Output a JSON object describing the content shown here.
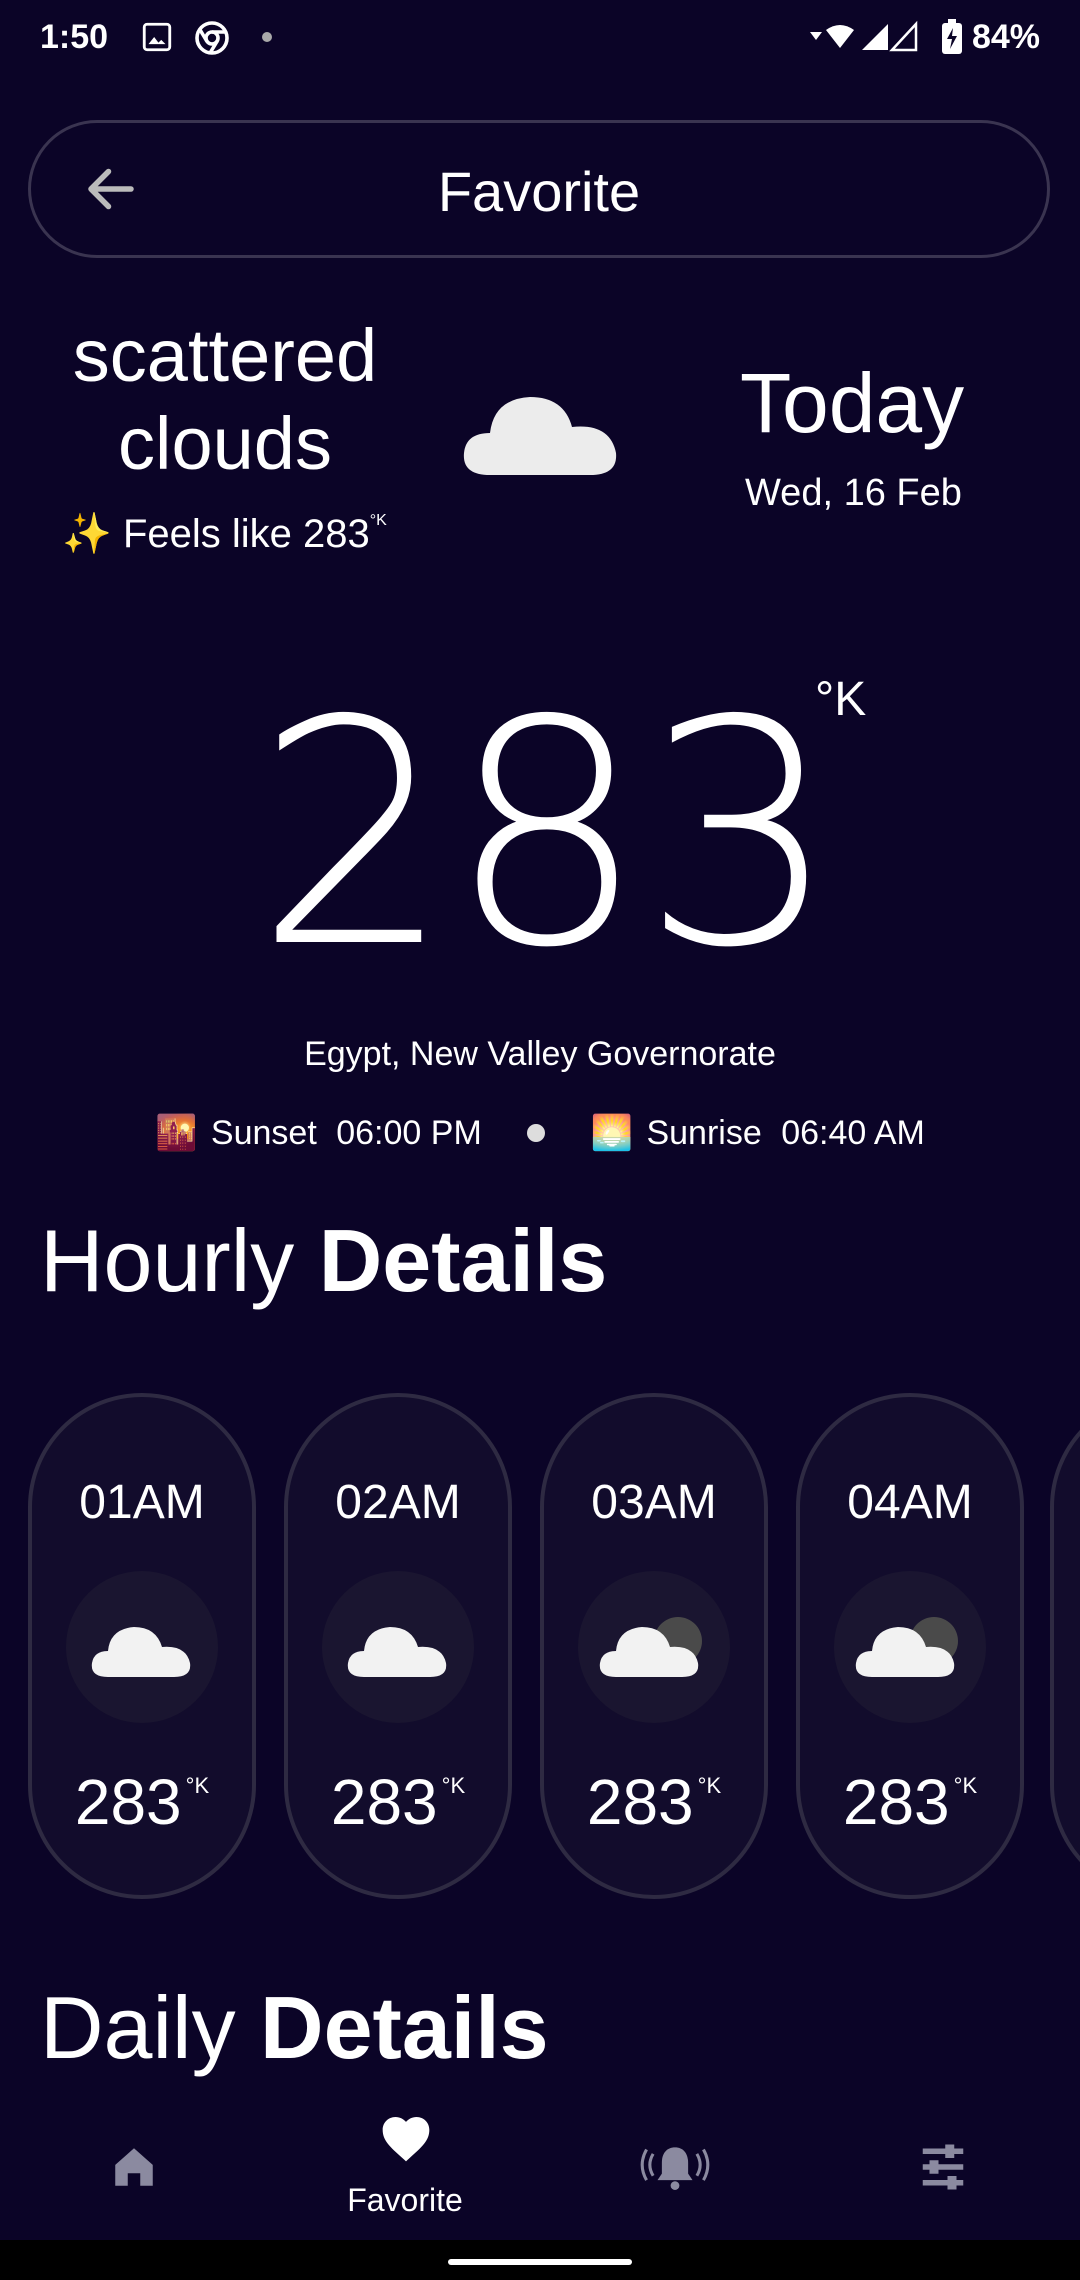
{
  "status_bar": {
    "time": "1:50",
    "battery": "84%"
  },
  "header": {
    "title": "Favorite"
  },
  "current": {
    "description_line1": "scattered",
    "description_line2": "clouds",
    "feels_like_label": "Feels like",
    "feels_like_value": "283",
    "feels_like_unit": "°K",
    "day_label": "Today",
    "date": "Wed, 16 Feb",
    "temperature": "283",
    "unit": "°K",
    "location": "Egypt, New Valley Governorate",
    "sunset_label": "Sunset",
    "sunset_time": "06:00 PM",
    "sunrise_label": "Sunrise",
    "sunrise_time": "06:40 AM"
  },
  "hourly": {
    "title_light": "Hourly",
    "title_bold": "Details",
    "items": [
      {
        "hour": "01AM",
        "temp": "283",
        "unit": "°K",
        "icon": "cloud-icon"
      },
      {
        "hour": "02AM",
        "temp": "283",
        "unit": "°K",
        "icon": "cloud-icon"
      },
      {
        "hour": "03AM",
        "temp": "283",
        "unit": "°K",
        "icon": "cloud-moon-icon"
      },
      {
        "hour": "04AM",
        "temp": "283",
        "unit": "°K",
        "icon": "cloud-moon-icon"
      }
    ]
  },
  "daily": {
    "title_light": "Daily",
    "title_bold": "Details"
  },
  "nav": {
    "items": [
      {
        "label": "",
        "icon": "home-icon"
      },
      {
        "label": "Favorite",
        "icon": "heart-icon"
      },
      {
        "label": "",
        "icon": "alert-bell-icon"
      },
      {
        "label": "",
        "icon": "settings-sliders-icon"
      }
    ]
  },
  "colors": {
    "background": "#0b0427",
    "card": "#120c2c",
    "card_border": "#2e2a42"
  }
}
